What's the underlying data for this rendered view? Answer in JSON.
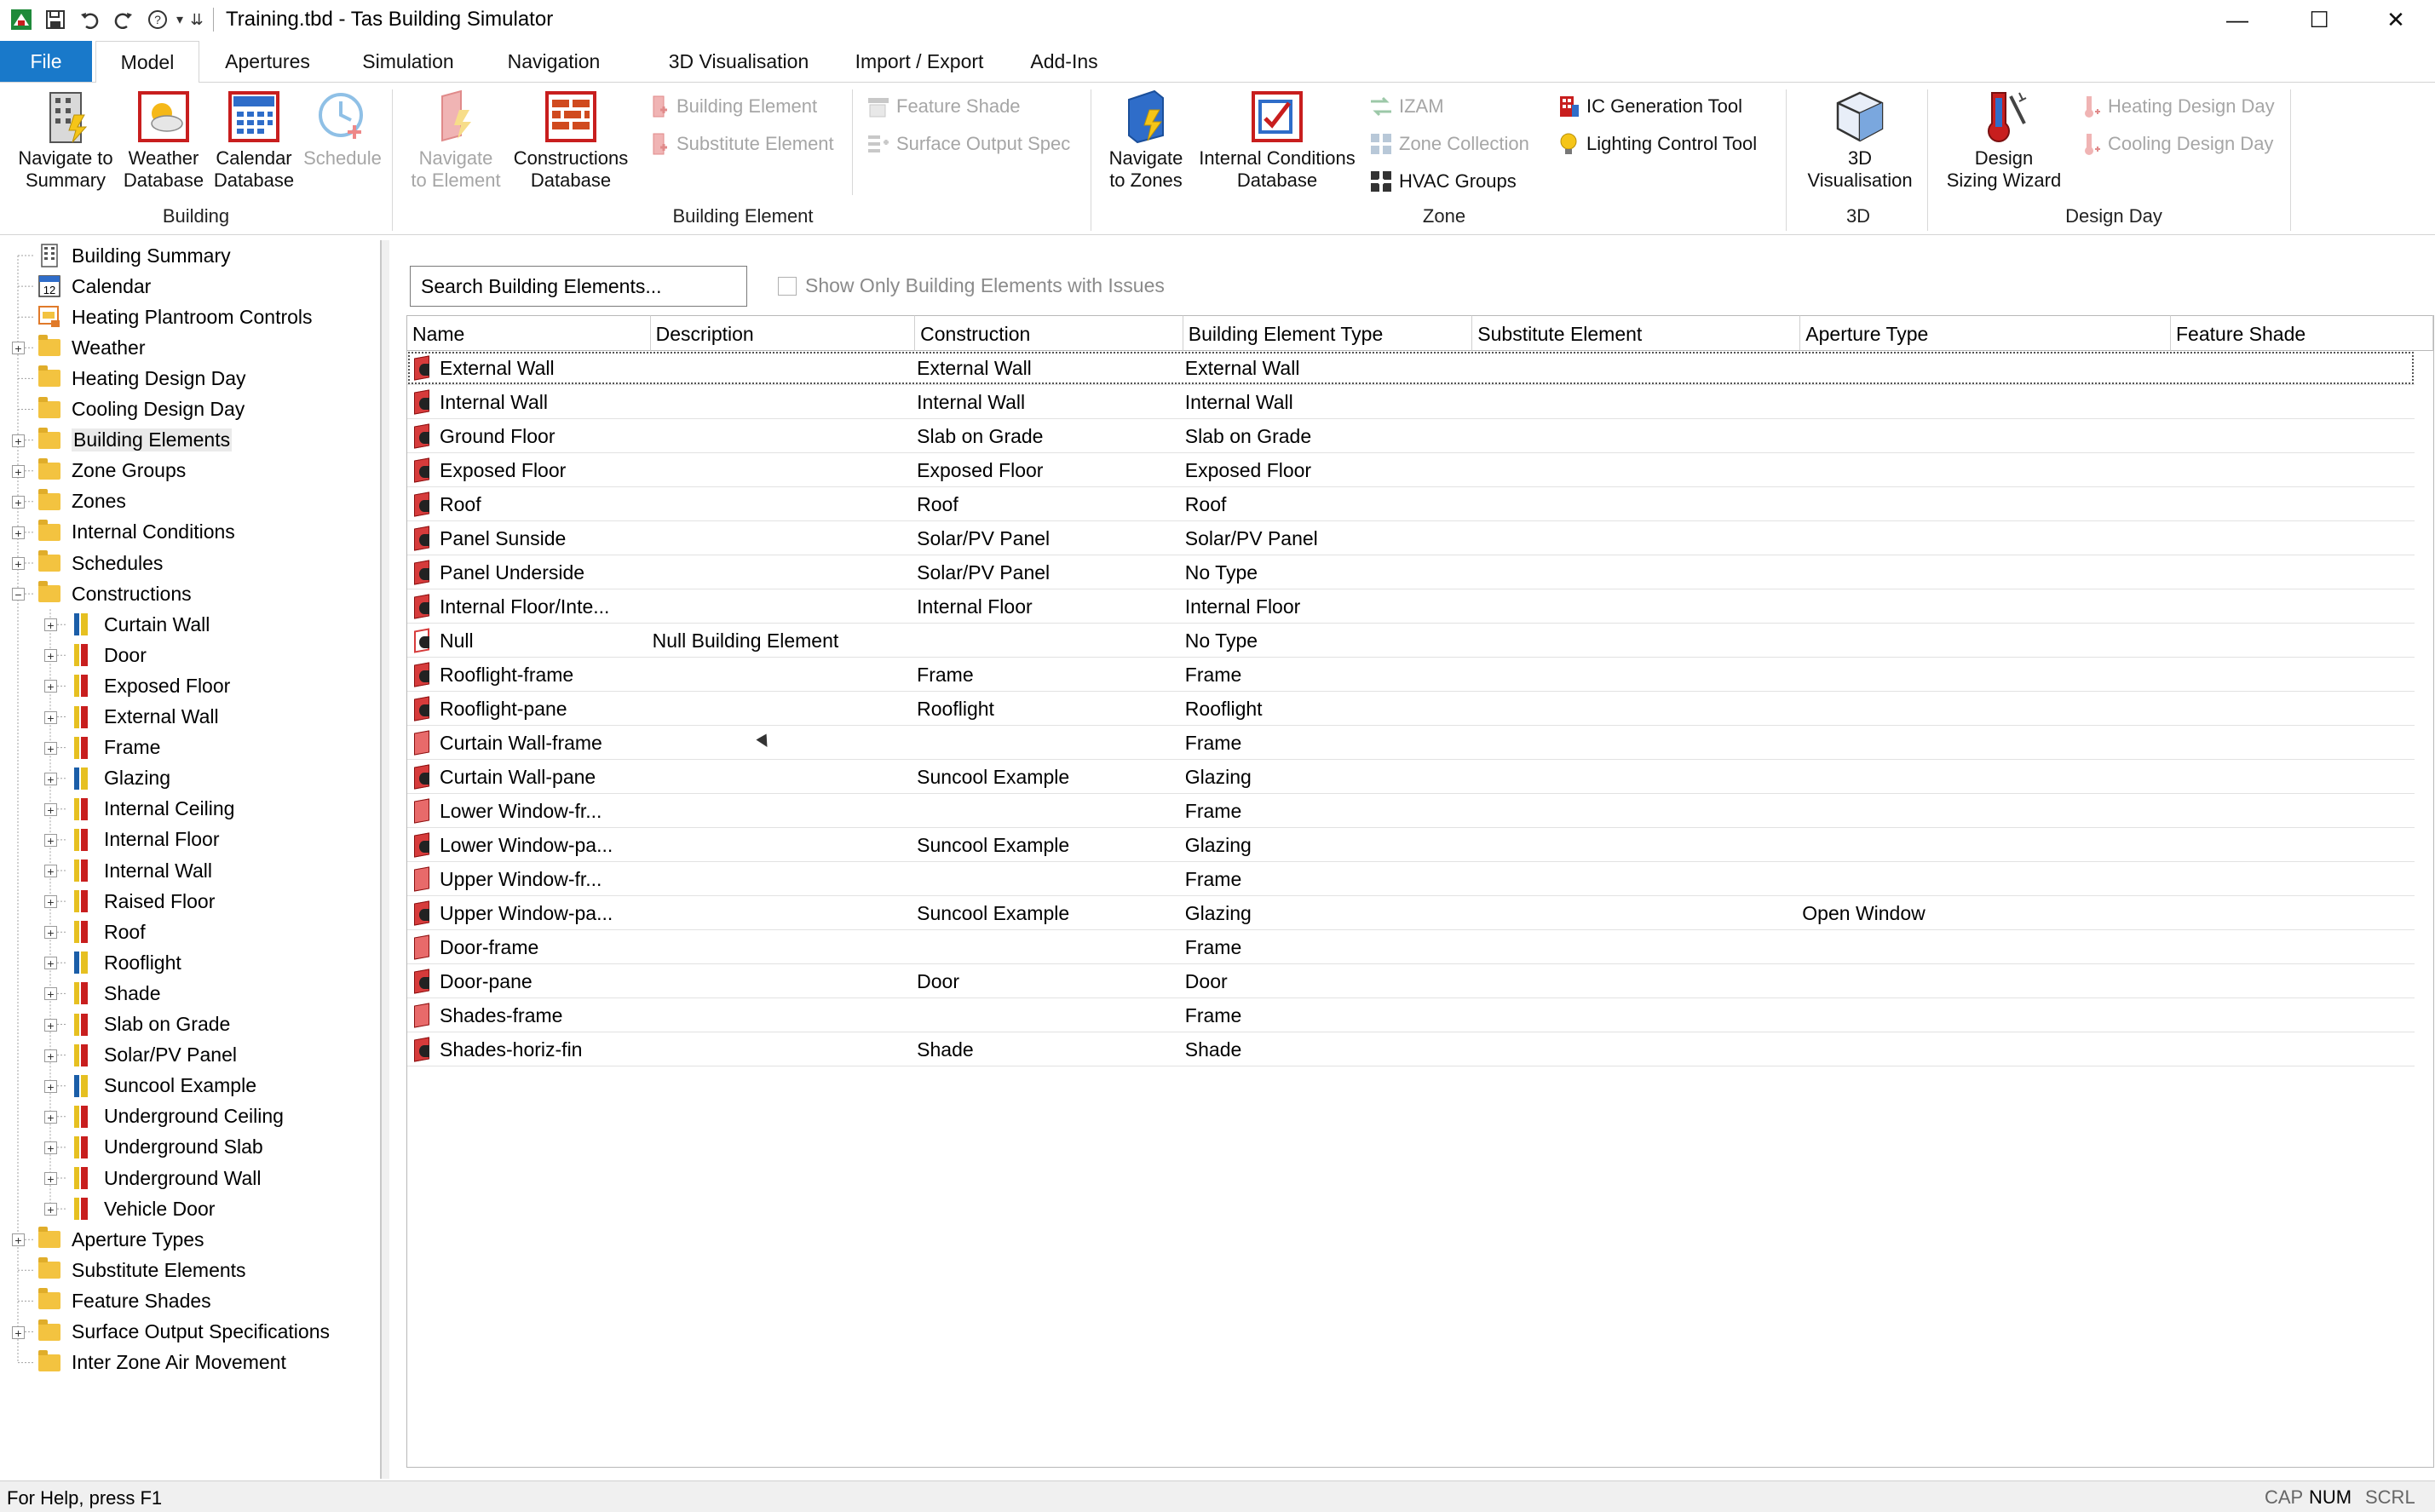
{
  "window": {
    "title": "Training.tbd - Tas Building Simulator",
    "minimize": "—",
    "maximize": "☐",
    "close": "✕"
  },
  "quick_access": {
    "icons": [
      "app-icon",
      "save-icon",
      "undo-icon",
      "redo-icon",
      "help-icon",
      "customize-icon"
    ],
    "help_glyph": "?",
    "dropdown_glyph": "▾",
    "customize_glyph": "⇊"
  },
  "tabs": [
    {
      "label": "File",
      "active": false,
      "file": true
    },
    {
      "label": "Model",
      "active": true
    },
    {
      "label": "Apertures"
    },
    {
      "label": "Simulation"
    },
    {
      "label": "Navigation"
    },
    {
      "label": "3D Visualisation"
    },
    {
      "label": "Import / Export"
    },
    {
      "label": "Add-Ins"
    }
  ],
  "ribbon": {
    "groups": {
      "building": "Building",
      "building_element": "Building Element",
      "zone": "Zone",
      "three_d": "3D",
      "design_day": "Design Day"
    },
    "building": {
      "navigate_summary": [
        "Navigate to",
        "Summary"
      ],
      "weather_db": [
        "Weather",
        "Database"
      ],
      "calendar_db": [
        "Calendar",
        "Database"
      ],
      "schedule": [
        "Schedule"
      ]
    },
    "building_element": {
      "navigate_element": [
        "Navigate",
        "to Element"
      ],
      "constructions_db": [
        "Constructions",
        "Database"
      ],
      "building_element": "Building Element",
      "substitute_element": "Substitute Element",
      "feature_shade": "Feature Shade",
      "surface_output_spec": "Surface Output Spec"
    },
    "zone": {
      "navigate_zones": [
        "Navigate",
        "to Zones"
      ],
      "internal_conditions_db": [
        "Internal Conditions",
        "Database"
      ],
      "izam": "IZAM",
      "zone_collection": "Zone Collection",
      "hvac_groups": "HVAC Groups",
      "ic_generation_tool": "IC Generation Tool",
      "lighting_control_tool": "Lighting Control Tool"
    },
    "three_d": {
      "visualisation": [
        "3D",
        "Visualisation"
      ]
    },
    "design_day": {
      "design_sizing_wizard": [
        "Design",
        "Sizing Wizard"
      ],
      "heating_design_day": "Heating Design Day",
      "cooling_design_day": "Cooling Design Day"
    }
  },
  "tree": {
    "items": [
      {
        "label": "Building Summary",
        "icon": "building-summary-icon",
        "level": 0,
        "expander": false
      },
      {
        "label": "Calendar",
        "icon": "calendar-icon",
        "level": 0,
        "expander": false
      },
      {
        "label": "Heating Plantroom Controls",
        "icon": "plantroom-icon",
        "level": 0,
        "expander": false
      },
      {
        "label": "Weather",
        "icon": "folder-icon",
        "level": 0,
        "expander": "+"
      },
      {
        "label": "Heating Design Day",
        "icon": "folder-icon",
        "level": 0,
        "expander": false
      },
      {
        "label": "Cooling Design Day",
        "icon": "folder-icon",
        "level": 0,
        "expander": false
      },
      {
        "label": "Building Elements",
        "icon": "folder-icon",
        "level": 0,
        "expander": "+",
        "selected": true
      },
      {
        "label": "Zone Groups",
        "icon": "folder-icon",
        "level": 0,
        "expander": "+"
      },
      {
        "label": "Zones",
        "icon": "folder-icon",
        "level": 0,
        "expander": "+"
      },
      {
        "label": "Internal Conditions",
        "icon": "folder-icon",
        "level": 0,
        "expander": "+"
      },
      {
        "label": "Schedules",
        "icon": "folder-icon",
        "level": 0,
        "expander": "+"
      },
      {
        "label": "Constructions",
        "icon": "folder-icon",
        "level": 0,
        "expander": "−"
      },
      {
        "label": "Curtain Wall",
        "icon": "construction-transparent-icon",
        "level": 1,
        "expander": "+"
      },
      {
        "label": "Door",
        "icon": "construction-opaque-icon",
        "level": 1,
        "expander": "+"
      },
      {
        "label": "Exposed Floor",
        "icon": "construction-opaque-icon",
        "level": 1,
        "expander": "+"
      },
      {
        "label": "External Wall",
        "icon": "construction-opaque-icon",
        "level": 1,
        "expander": "+"
      },
      {
        "label": "Frame",
        "icon": "construction-opaque-icon",
        "level": 1,
        "expander": "+"
      },
      {
        "label": "Glazing",
        "icon": "construction-transparent-icon",
        "level": 1,
        "expander": "+"
      },
      {
        "label": "Internal Ceiling",
        "icon": "construction-opaque-icon",
        "level": 1,
        "expander": "+"
      },
      {
        "label": "Internal Floor",
        "icon": "construction-opaque-icon",
        "level": 1,
        "expander": "+"
      },
      {
        "label": "Internal Wall",
        "icon": "construction-opaque-icon",
        "level": 1,
        "expander": "+"
      },
      {
        "label": "Raised Floor",
        "icon": "construction-opaque-icon",
        "level": 1,
        "expander": "+"
      },
      {
        "label": "Roof",
        "icon": "construction-opaque-icon",
        "level": 1,
        "expander": "+"
      },
      {
        "label": "Rooflight",
        "icon": "construction-transparent-icon",
        "level": 1,
        "expander": "+"
      },
      {
        "label": "Shade",
        "icon": "construction-opaque-icon",
        "level": 1,
        "expander": "+"
      },
      {
        "label": "Slab on Grade",
        "icon": "construction-opaque-icon",
        "level": 1,
        "expander": "+"
      },
      {
        "label": "Solar/PV Panel",
        "icon": "construction-opaque-icon",
        "level": 1,
        "expander": "+"
      },
      {
        "label": "Suncool Example",
        "icon": "construction-transparent-icon",
        "level": 1,
        "expander": "+"
      },
      {
        "label": "Underground Ceiling",
        "icon": "construction-opaque-icon",
        "level": 1,
        "expander": "+"
      },
      {
        "label": "Underground Slab",
        "icon": "construction-opaque-icon",
        "level": 1,
        "expander": "+"
      },
      {
        "label": "Underground Wall",
        "icon": "construction-opaque-icon",
        "level": 1,
        "expander": "+"
      },
      {
        "label": "Vehicle Door",
        "icon": "construction-opaque-icon",
        "level": 1,
        "expander": "+"
      },
      {
        "label": "Aperture Types",
        "icon": "folder-icon",
        "level": 0,
        "expander": "+"
      },
      {
        "label": "Substitute Elements",
        "icon": "folder-icon",
        "level": 0,
        "expander": false
      },
      {
        "label": "Feature Shades",
        "icon": "folder-icon",
        "level": 0,
        "expander": false
      },
      {
        "label": "Surface Output Specifications",
        "icon": "folder-icon",
        "level": 0,
        "expander": "+"
      },
      {
        "label": "Inter Zone Air Movement",
        "icon": "folder-icon",
        "level": 0,
        "expander": false
      }
    ]
  },
  "main": {
    "search_placeholder": "Search Building Elements...",
    "issues_checkbox_label": "Show Only Building Elements with Issues",
    "issues_checked": false,
    "columns": [
      "Name",
      "Description",
      "Construction",
      "Building Element Type",
      "Substitute Element",
      "Aperture Type",
      "Feature Shade"
    ],
    "rows": [
      {
        "name": "External Wall",
        "description": "",
        "construction": "External Wall",
        "type": "External Wall",
        "substitute": "",
        "aperture": "",
        "shade": "",
        "icon": "solid"
      },
      {
        "name": "Internal Wall",
        "description": "",
        "construction": "Internal Wall",
        "type": "Internal Wall",
        "substitute": "",
        "aperture": "",
        "shade": "",
        "icon": "solid"
      },
      {
        "name": "Ground Floor",
        "description": "",
        "construction": "Slab on Grade",
        "type": "Slab on Grade",
        "substitute": "",
        "aperture": "",
        "shade": "",
        "icon": "solid"
      },
      {
        "name": "Exposed Floor",
        "description": "",
        "construction": "Exposed Floor",
        "type": "Exposed Floor",
        "substitute": "",
        "aperture": "",
        "shade": "",
        "icon": "solid"
      },
      {
        "name": "Roof",
        "description": "",
        "construction": "Roof",
        "type": "Roof",
        "substitute": "",
        "aperture": "",
        "shade": "",
        "icon": "solid"
      },
      {
        "name": "Panel Sunside",
        "description": "",
        "construction": "Solar/PV Panel",
        "type": "Solar/PV Panel",
        "substitute": "",
        "aperture": "",
        "shade": "",
        "icon": "solid"
      },
      {
        "name": "Panel Underside",
        "description": "",
        "construction": "Solar/PV Panel",
        "type": "No Type",
        "substitute": "",
        "aperture": "",
        "shade": "",
        "icon": "solid"
      },
      {
        "name": "Internal Floor/Inte...",
        "description": "",
        "construction": "Internal Floor",
        "type": "Internal Floor",
        "substitute": "",
        "aperture": "",
        "shade": "",
        "icon": "solid"
      },
      {
        "name": "Null",
        "description": "Null Building Element",
        "construction": "",
        "type": "No Type",
        "substitute": "",
        "aperture": "",
        "shade": "",
        "icon": "null"
      },
      {
        "name": "Rooflight-frame",
        "description": "",
        "construction": "Frame",
        "type": "Frame",
        "substitute": "",
        "aperture": "",
        "shade": "",
        "icon": "solid"
      },
      {
        "name": "Rooflight-pane",
        "description": "",
        "construction": "Rooflight",
        "type": "Rooflight",
        "substitute": "",
        "aperture": "",
        "shade": "",
        "icon": "solid"
      },
      {
        "name": "Curtain Wall-frame",
        "description": "",
        "construction": "",
        "type": "Frame",
        "substitute": "",
        "aperture": "",
        "shade": "",
        "icon": "nodark"
      },
      {
        "name": "Curtain Wall-pane",
        "description": "",
        "construction": "Suncool Example",
        "type": "Glazing",
        "substitute": "",
        "aperture": "",
        "shade": "",
        "icon": "solid"
      },
      {
        "name": "Lower Window-fr...",
        "description": "",
        "construction": "",
        "type": "Frame",
        "substitute": "",
        "aperture": "",
        "shade": "",
        "icon": "nodark"
      },
      {
        "name": "Lower Window-pa...",
        "description": "",
        "construction": "Suncool Example",
        "type": "Glazing",
        "substitute": "",
        "aperture": "",
        "shade": "",
        "icon": "solid"
      },
      {
        "name": "Upper Window-fr...",
        "description": "",
        "construction": "",
        "type": "Frame",
        "substitute": "",
        "aperture": "",
        "shade": "",
        "icon": "nodark"
      },
      {
        "name": "Upper Window-pa...",
        "description": "",
        "construction": "Suncool Example",
        "type": "Glazing",
        "substitute": "",
        "aperture": "Open Window",
        "shade": "",
        "icon": "solid"
      },
      {
        "name": "Door-frame",
        "description": "",
        "construction": "",
        "type": "Frame",
        "substitute": "",
        "aperture": "",
        "shade": "",
        "icon": "nodark"
      },
      {
        "name": "Door-pane",
        "description": "",
        "construction": "Door",
        "type": "Door",
        "substitute": "",
        "aperture": "",
        "shade": "",
        "icon": "solid"
      },
      {
        "name": "Shades-frame",
        "description": "",
        "construction": "",
        "type": "Frame",
        "substitute": "",
        "aperture": "",
        "shade": "",
        "icon": "nodark"
      },
      {
        "name": "Shades-horiz-fin",
        "description": "",
        "construction": "Shade",
        "type": "Shade",
        "substitute": "",
        "aperture": "",
        "shade": "",
        "icon": "solid"
      }
    ]
  },
  "status": {
    "help": "For Help, press F1",
    "cap": "CAP",
    "num": "NUM",
    "scrl": "SCRL"
  },
  "colors": {
    "file_tab": "#1979ca",
    "folder": "#f3c340",
    "element_red": "#d63b3b"
  }
}
